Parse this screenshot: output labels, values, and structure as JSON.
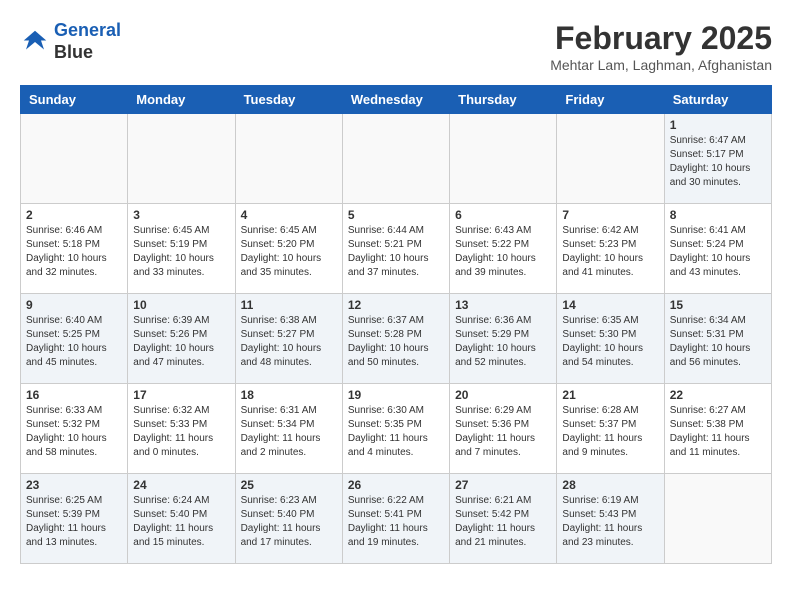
{
  "logo": {
    "line1": "General",
    "line2": "Blue"
  },
  "title": "February 2025",
  "location": "Mehtar Lam, Laghman, Afghanistan",
  "headers": [
    "Sunday",
    "Monday",
    "Tuesday",
    "Wednesday",
    "Thursday",
    "Friday",
    "Saturday"
  ],
  "weeks": [
    [
      {
        "day": "",
        "info": ""
      },
      {
        "day": "",
        "info": ""
      },
      {
        "day": "",
        "info": ""
      },
      {
        "day": "",
        "info": ""
      },
      {
        "day": "",
        "info": ""
      },
      {
        "day": "",
        "info": ""
      },
      {
        "day": "1",
        "info": "Sunrise: 6:47 AM\nSunset: 5:17 PM\nDaylight: 10 hours\nand 30 minutes."
      }
    ],
    [
      {
        "day": "2",
        "info": "Sunrise: 6:46 AM\nSunset: 5:18 PM\nDaylight: 10 hours\nand 32 minutes."
      },
      {
        "day": "3",
        "info": "Sunrise: 6:45 AM\nSunset: 5:19 PM\nDaylight: 10 hours\nand 33 minutes."
      },
      {
        "day": "4",
        "info": "Sunrise: 6:45 AM\nSunset: 5:20 PM\nDaylight: 10 hours\nand 35 minutes."
      },
      {
        "day": "5",
        "info": "Sunrise: 6:44 AM\nSunset: 5:21 PM\nDaylight: 10 hours\nand 37 minutes."
      },
      {
        "day": "6",
        "info": "Sunrise: 6:43 AM\nSunset: 5:22 PM\nDaylight: 10 hours\nand 39 minutes."
      },
      {
        "day": "7",
        "info": "Sunrise: 6:42 AM\nSunset: 5:23 PM\nDaylight: 10 hours\nand 41 minutes."
      },
      {
        "day": "8",
        "info": "Sunrise: 6:41 AM\nSunset: 5:24 PM\nDaylight: 10 hours\nand 43 minutes."
      }
    ],
    [
      {
        "day": "9",
        "info": "Sunrise: 6:40 AM\nSunset: 5:25 PM\nDaylight: 10 hours\nand 45 minutes."
      },
      {
        "day": "10",
        "info": "Sunrise: 6:39 AM\nSunset: 5:26 PM\nDaylight: 10 hours\nand 47 minutes."
      },
      {
        "day": "11",
        "info": "Sunrise: 6:38 AM\nSunset: 5:27 PM\nDaylight: 10 hours\nand 48 minutes."
      },
      {
        "day": "12",
        "info": "Sunrise: 6:37 AM\nSunset: 5:28 PM\nDaylight: 10 hours\nand 50 minutes."
      },
      {
        "day": "13",
        "info": "Sunrise: 6:36 AM\nSunset: 5:29 PM\nDaylight: 10 hours\nand 52 minutes."
      },
      {
        "day": "14",
        "info": "Sunrise: 6:35 AM\nSunset: 5:30 PM\nDaylight: 10 hours\nand 54 minutes."
      },
      {
        "day": "15",
        "info": "Sunrise: 6:34 AM\nSunset: 5:31 PM\nDaylight: 10 hours\nand 56 minutes."
      }
    ],
    [
      {
        "day": "16",
        "info": "Sunrise: 6:33 AM\nSunset: 5:32 PM\nDaylight: 10 hours\nand 58 minutes."
      },
      {
        "day": "17",
        "info": "Sunrise: 6:32 AM\nSunset: 5:33 PM\nDaylight: 11 hours\nand 0 minutes."
      },
      {
        "day": "18",
        "info": "Sunrise: 6:31 AM\nSunset: 5:34 PM\nDaylight: 11 hours\nand 2 minutes."
      },
      {
        "day": "19",
        "info": "Sunrise: 6:30 AM\nSunset: 5:35 PM\nDaylight: 11 hours\nand 4 minutes."
      },
      {
        "day": "20",
        "info": "Sunrise: 6:29 AM\nSunset: 5:36 PM\nDaylight: 11 hours\nand 7 minutes."
      },
      {
        "day": "21",
        "info": "Sunrise: 6:28 AM\nSunset: 5:37 PM\nDaylight: 11 hours\nand 9 minutes."
      },
      {
        "day": "22",
        "info": "Sunrise: 6:27 AM\nSunset: 5:38 PM\nDaylight: 11 hours\nand 11 minutes."
      }
    ],
    [
      {
        "day": "23",
        "info": "Sunrise: 6:25 AM\nSunset: 5:39 PM\nDaylight: 11 hours\nand 13 minutes."
      },
      {
        "day": "24",
        "info": "Sunrise: 6:24 AM\nSunset: 5:40 PM\nDaylight: 11 hours\nand 15 minutes."
      },
      {
        "day": "25",
        "info": "Sunrise: 6:23 AM\nSunset: 5:40 PM\nDaylight: 11 hours\nand 17 minutes."
      },
      {
        "day": "26",
        "info": "Sunrise: 6:22 AM\nSunset: 5:41 PM\nDaylight: 11 hours\nand 19 minutes."
      },
      {
        "day": "27",
        "info": "Sunrise: 6:21 AM\nSunset: 5:42 PM\nDaylight: 11 hours\nand 21 minutes."
      },
      {
        "day": "28",
        "info": "Sunrise: 6:19 AM\nSunset: 5:43 PM\nDaylight: 11 hours\nand 23 minutes."
      },
      {
        "day": "",
        "info": ""
      }
    ]
  ]
}
